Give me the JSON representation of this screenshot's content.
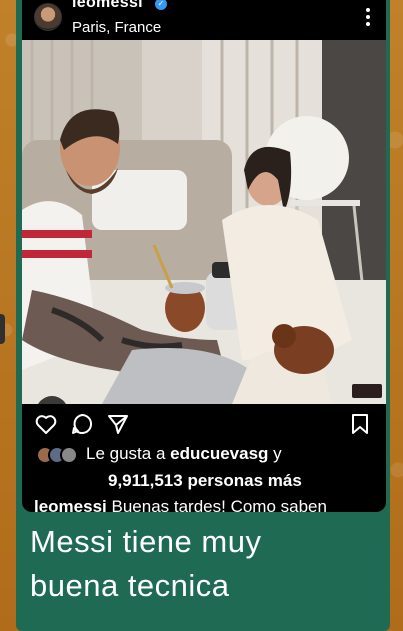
{
  "post": {
    "username": "leomessi",
    "location": "Paris, France",
    "liked_by_prefix": "Le gusta a",
    "liked_by_user": "educuevasg",
    "liked_by_suffix": "y",
    "likes_count": "9,911,513",
    "likes_suffix": "personas más",
    "caption_user": "leomessi",
    "caption_text": "Buenas tardes! Como saben"
  },
  "icons": {
    "more": "more-vertical-icon",
    "like": "heart-icon",
    "comment": "comment-icon",
    "share": "send-icon",
    "save": "bookmark-icon",
    "tags": "user-tag-icon",
    "verified": "verified-badge-icon"
  },
  "colors": {
    "background": "#b8741f",
    "card": "#1f6a52",
    "post_bg": "#000000",
    "verified": "#3897f0"
  },
  "comment": {
    "line1": "Messi tiene muy",
    "line2": "buena tecnica"
  }
}
